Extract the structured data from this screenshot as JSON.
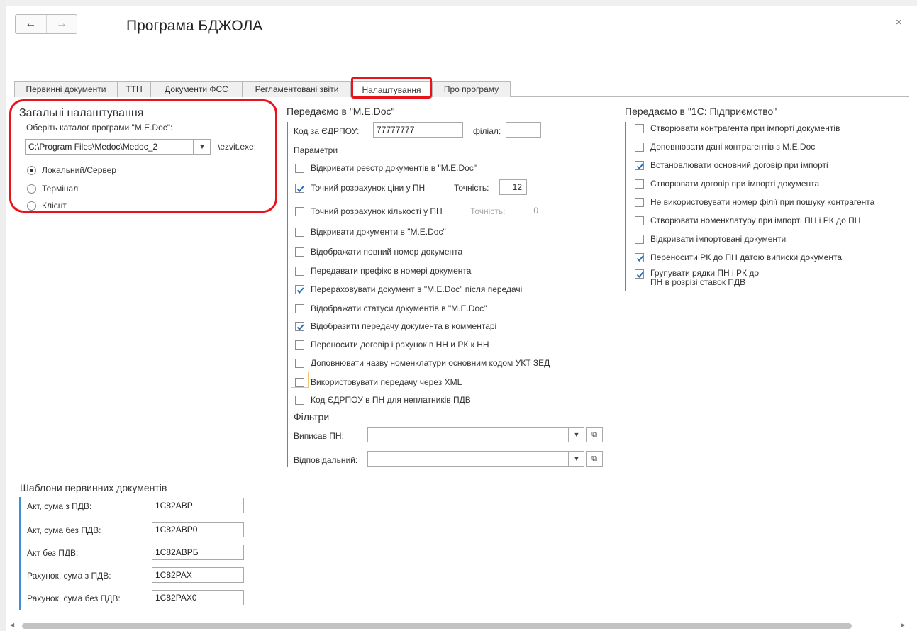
{
  "window": {
    "title": "Програма БДЖОЛА",
    "back_icon": "arrow-left-icon",
    "forward_icon": "arrow-right-icon",
    "close_label": "×"
  },
  "tabs": [
    {
      "label": "Первинні документи",
      "active": false
    },
    {
      "label": "ТТН",
      "active": false
    },
    {
      "label": "Документи ФСС",
      "active": false
    },
    {
      "label": "Регламентовані звіти",
      "active": false
    },
    {
      "label": "Налаштування",
      "active": true
    },
    {
      "label": "Про програму",
      "active": false
    }
  ],
  "general": {
    "title": "Загальні налаштування",
    "catalog_label": "Оберіть каталог програми \"M.E.Doc\":",
    "catalog_value": "C:\\Program Files\\Medoc\\Medoc_2",
    "exe_suffix": "\\ezvit.exe:",
    "mode_options": [
      {
        "label": "Локальний/Сервер",
        "selected": true
      },
      {
        "label": "Термінал",
        "selected": false
      },
      {
        "label": "Клієнт",
        "selected": false
      }
    ]
  },
  "medoc": {
    "title": "Передаємо в \"M.E.Doc\"",
    "edrpou_label": "Код за ЄДРПОУ:",
    "edrpou_value": "77777777",
    "branch_label": "філіал:",
    "branch_value": "",
    "params_title": "Параметри",
    "params": [
      {
        "label": "Відкривати реєстр документів в \"M.E.Doc\"",
        "checked": false
      },
      {
        "label": "Точний розрахунок ціни у ПН",
        "checked": true
      },
      {
        "label": "Точний розрахунок кількості у ПН",
        "checked": false
      },
      {
        "label": "Відкривати документи в \"M.E.Doc\"",
        "checked": false
      },
      {
        "label": "Відображати повний номер документа",
        "checked": false
      },
      {
        "label": "Передавати префікс в номері документа",
        "checked": false
      },
      {
        "label": "Перераховувати документ в \"M.E.Doc\" після передачі",
        "checked": true
      },
      {
        "label": "Відображати статуси документів в \"M.E.Doc\"",
        "checked": false
      },
      {
        "label": "Відобразити передачу документа в комментарі",
        "checked": true
      },
      {
        "label": "Переносити договір і рахунок в НН и РК к НН",
        "checked": false
      },
      {
        "label": "Доповнювати назву номенклатури основним кодом УКТ ЗЕД",
        "checked": false
      },
      {
        "label": "Використовувати передачу через XML",
        "checked": false
      },
      {
        "label": "Код ЄДРПОУ в ПН для неплатників ПДВ",
        "checked": false
      }
    ],
    "price_precision_label": "Точність:",
    "price_precision_value": "12",
    "qty_precision_label": "Точність:",
    "qty_precision_value": "0",
    "filters_title": "Фільтри",
    "filter_issued_label": "Виписав ПН:",
    "filter_issued_value": "",
    "filter_responsible_label": "Відповідальний:",
    "filter_responsible_value": ""
  },
  "onec": {
    "title": "Передаємо в \"1С: Підприємство\"",
    "options": [
      {
        "label": "Створювати контрагента при імпорті документів",
        "checked": false
      },
      {
        "label": "Доповнювати дані контрагентів з M.E.Doc",
        "checked": false
      },
      {
        "label": "Встановлювати основний договір при імпорті",
        "checked": true
      },
      {
        "label": "Створювати договір при імпорті документа",
        "checked": false
      },
      {
        "label": "Не використовувати номер філії при пошуку контрагента",
        "checked": false
      },
      {
        "label": "Створювати номенклатуру при імпорті ПН і РК до ПН",
        "checked": false
      },
      {
        "label": "Відкривати імпортовані документи",
        "checked": false
      },
      {
        "label": "Переносити РК до ПН датою виписки документа",
        "checked": true
      }
    ],
    "group_rows": {
      "line1": "Групувати рядки ПН і РК до",
      "line2": "ПН в розрізі ставок ПДВ",
      "checked": true
    }
  },
  "templates": {
    "title": "Шаблони первинних документів",
    "rows": [
      {
        "label": "Акт, сума з ПДВ:",
        "value": "1С82АВР"
      },
      {
        "label": "Акт, сума без ПДВ:",
        "value": "1С82АВР0"
      },
      {
        "label": "Акт без ПДВ:",
        "value": "1С82АВРБ"
      },
      {
        "label": "Рахунок, сума з ПДВ:",
        "value": "1С82РАХ"
      },
      {
        "label": "Рахунок, сума без ПДВ:",
        "value": "1С82РАХ0"
      }
    ]
  },
  "colors": {
    "accent_line": "#3d8fd6",
    "highlight_red": "#e8141c",
    "checkmark": "#2a6fb8"
  }
}
